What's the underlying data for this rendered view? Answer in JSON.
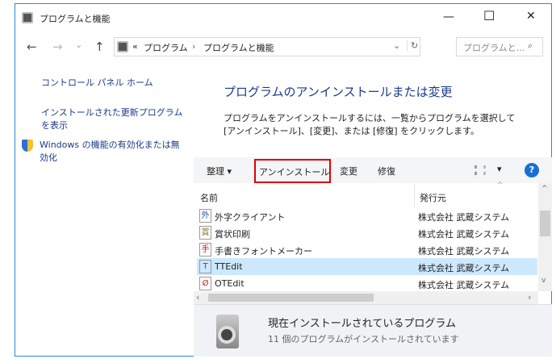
{
  "window": {
    "title": "プログラムと機能",
    "minimize": "—",
    "maximize": "☐",
    "close": "✕"
  },
  "nav": {
    "back": "←",
    "forward": "→",
    "recent": "⌄",
    "up": "↑",
    "breadcrumb_prefix": "«",
    "crumbs": [
      "プログラム",
      "プログラムと機能"
    ],
    "sep": "›",
    "dropdown": "⌄",
    "refresh": "↻",
    "search_placeholder": "プログラムと...",
    "search_icon": "⌕"
  },
  "sidebar": {
    "home": "コントロール パネル ホーム",
    "updates": "インストールされた更新プログラムを表示",
    "features": "Windows の機能の有効化または無効化"
  },
  "main": {
    "heading": "プログラムのアンインストールまたは変更",
    "description": "プログラムをアンインストールするには、一覧からプログラムを選択して [アンインストール]、[変更]、または [修復] をクリックします。"
  },
  "toolbar": {
    "organize": "整理 ▾",
    "uninstall": "アンインストール",
    "change": "変更",
    "repair": "修復",
    "view": "▾",
    "help": "?"
  },
  "list": {
    "columns": [
      "名前",
      "発行元"
    ],
    "rows": [
      {
        "name": "外字クライアント",
        "publisher": "株式会社 武蔵システム",
        "icon": "外",
        "color": "#1b4fa0",
        "selected": false
      },
      {
        "name": "賞状印刷",
        "publisher": "株式会社 武蔵システム",
        "icon": "賞",
        "color": "#8a7a3a",
        "selected": false
      },
      {
        "name": "手書きフォントメーカー",
        "publisher": "株式会社 武蔵システム",
        "icon": "手",
        "color": "#d01010",
        "selected": false
      },
      {
        "name": "TTEdit",
        "publisher": "株式会社 武蔵システム",
        "icon": "T",
        "color": "#c02020",
        "selected": true
      },
      {
        "name": "OTEdit",
        "publisher": "株式会社 武蔵システム",
        "icon": "Ø",
        "color": "#c02020",
        "selected": false
      }
    ]
  },
  "details": {
    "title": "現在インストールされているプログラム",
    "count": "11 個のプログラムがインストールされています"
  },
  "highlight_color": "#e00000"
}
